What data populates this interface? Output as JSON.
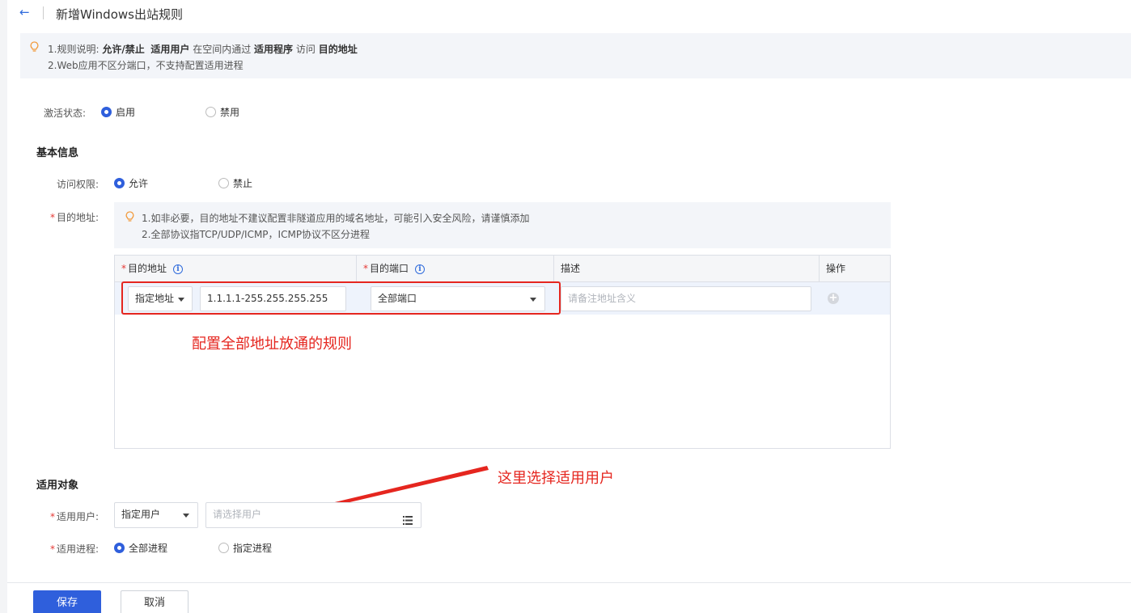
{
  "header": {
    "back_icon": "arrow-left-icon",
    "title": "新增Windows出站规则"
  },
  "tip1": {
    "line1_prefix": "1.规则说明:",
    "line1_b1": "允许/禁止",
    "line1_b2": "适用用户",
    "line1_mid": "在空间内通过",
    "line1_b3": "适用程序",
    "line1_mid2": "访问",
    "line1_b4": "目的地址",
    "line2": "2.Web应用不区分端口，不支持配置适用进程"
  },
  "status": {
    "label": "激活状态:",
    "enabled": "启用",
    "disabled": "禁用",
    "selected": "enabled"
  },
  "basic": {
    "title": "基本信息",
    "access_label": "访问权限:",
    "allow": "允许",
    "deny": "禁止",
    "dest_label": "目的地址:",
    "tip_line1": "1.如非必要，目的地址不建议配置非隧道应用的域名地址，可能引入安全风险，请谨慎添加",
    "tip_line2": "2.全部协议指TCP/UDP/ICMP，ICMP协议不区分进程"
  },
  "table": {
    "headers": {
      "address": "目的地址",
      "port": "目的端口",
      "desc": "描述",
      "op": "操作"
    },
    "row": {
      "addr_type": "指定地址",
      "addr_value": "1.1.1.1-255.255.255.255",
      "port_value": "全部端口",
      "desc_placeholder": "请备注地址含义"
    }
  },
  "annotations": {
    "rule": "配置全部地址放通的规则",
    "user": "这里选择适用用户"
  },
  "target": {
    "title": "适用对象",
    "user_label": "适用用户:",
    "user_type": "指定用户",
    "user_placeholder": "请选择用户",
    "process_label": "适用进程:",
    "all_process": "全部进程",
    "specific_process": "指定进程"
  },
  "buttons": {
    "save": "保存",
    "cancel": "取消"
  },
  "colors": {
    "primary": "#2f5fdc",
    "annotation": "#e5261f"
  }
}
